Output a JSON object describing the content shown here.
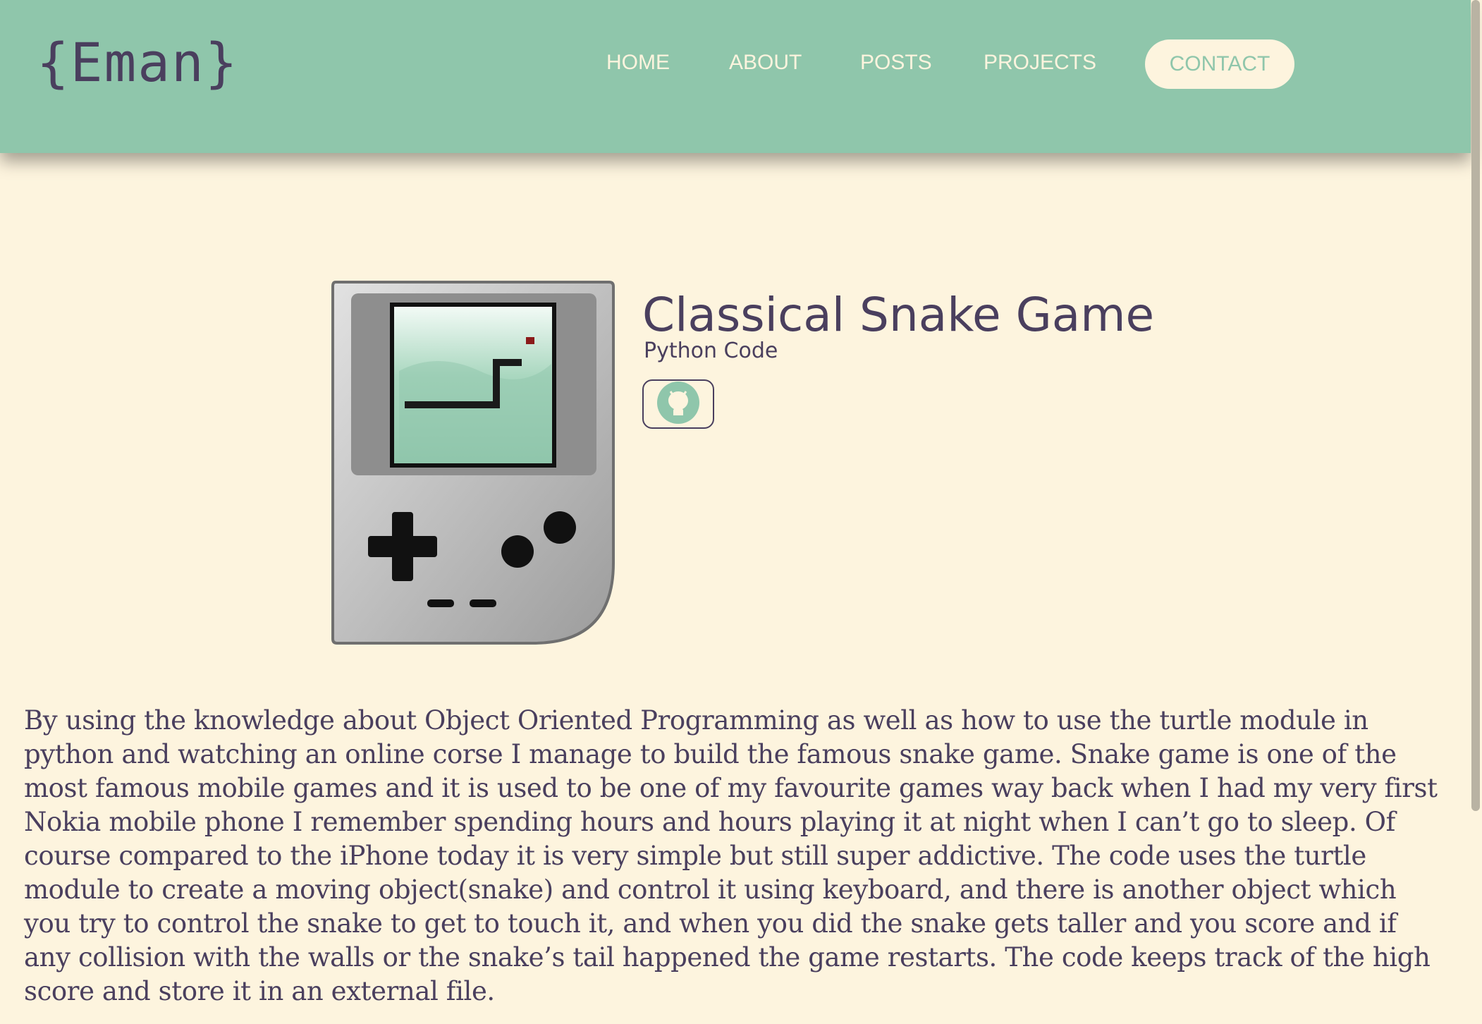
{
  "header": {
    "logo": "{Eman}",
    "nav": {
      "home": "HOME",
      "about": "ABOUT",
      "posts": "POSTS",
      "projects": "PROJECTS",
      "contact": "CONTACT"
    }
  },
  "project": {
    "title": "Classical Snake Game",
    "subtitle": "Python Code",
    "image_icon": "gameboy-snake-icon",
    "link_icon": "github-icon",
    "description": "By using the knowledge about Object Oriented Programming as well as how to use the turtle module in python and watching an online corse I manage to build the famous snake game. Snake game is one of the most famous mobile games and it is used to be one of my favourite games way back when I had my very first Nokia mobile phone I remember spending hours and hours playing it at night when I can’t go to sleep. Of course compared to the iPhone today it is very simple but still super addictive. The code uses the turtle module to create a moving object(snake) and control it using keyboard, and there is another object which you try to control the snake to get to touch it, and when you did the snake gets taller and you score and if any collision with the walls or the snake’s tail happened the game restarts. The code keeps track of the high score and store it in an external file."
  },
  "colors": {
    "header_bg": "#8fc6ab",
    "page_bg": "#fdf4de",
    "text": "#4a3f5e",
    "accent": "#8fc6ab"
  }
}
